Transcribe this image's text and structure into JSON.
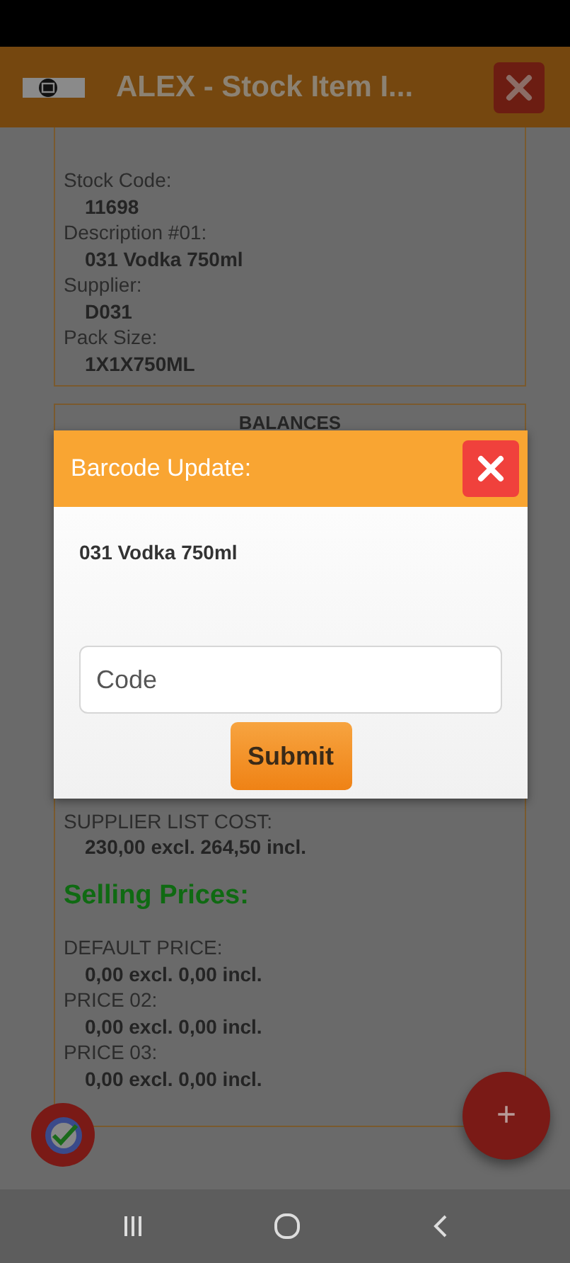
{
  "header": {
    "title": "ALEX - Stock Item I..."
  },
  "details": [
    {
      "label": "Stock Code:",
      "value": "11698"
    },
    {
      "label": "Description #01:",
      "value": "031 Vodka 750ml"
    },
    {
      "label": "Supplier:",
      "value": "D031"
    },
    {
      "label": "Pack Size:",
      "value": "1X1X750ML"
    }
  ],
  "balances": {
    "heading": "BALANCES",
    "cost": {
      "label": "SUPPLIER LIST COST:",
      "value": "**230,00** excl. **264,50** incl."
    },
    "selling_heading": "Selling Prices:",
    "prices": [
      {
        "label": "DEFAULT PRICE:",
        "value": "**0,00** excl. **0,00** incl."
      },
      {
        "label": "PRICE 02:",
        "value": "**0,00** excl. **0,00** incl."
      },
      {
        "label": "PRICE 03:",
        "value": "**0,00** excl. **0,00** incl."
      }
    ]
  },
  "dialog": {
    "title": "Barcode Update:",
    "item": "031 Vodka 750ml",
    "field": {
      "placeholder": "Code"
    },
    "submit": "Submit"
  },
  "fab": {
    "label": "+"
  }
}
